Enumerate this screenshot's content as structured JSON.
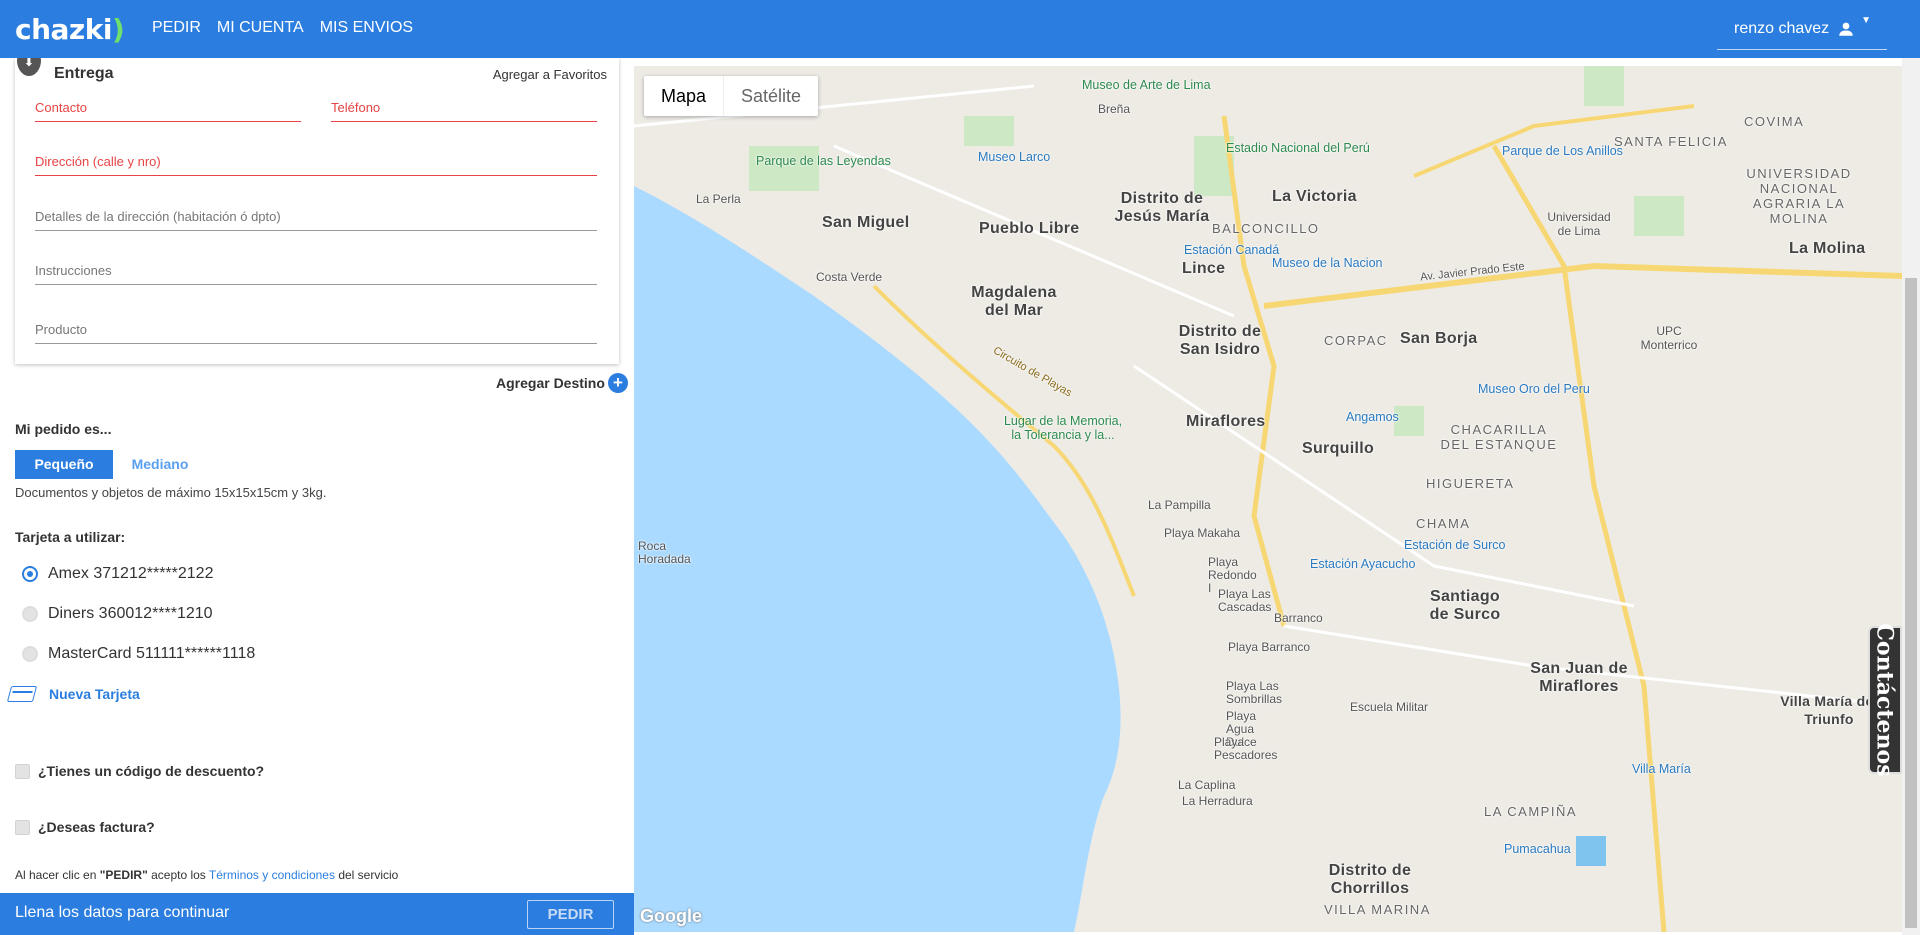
{
  "header": {
    "logo": "chazki",
    "nav": [
      "PEDIR",
      "MI CUENTA",
      "MIS ENVIOS"
    ],
    "user_name": "renzo chavez"
  },
  "delivery_card": {
    "title": "Entrega",
    "favorites_link": "Agregar a Favoritos",
    "contact_placeholder": "Contacto",
    "phone_placeholder": "Teléfono",
    "address_placeholder": "Dirección (calle y nro)",
    "details_placeholder": "Detalles de la dirección (habitación ó dpto)",
    "instructions_placeholder": "Instrucciones",
    "product_placeholder": "Producto"
  },
  "add_destination_label": "Agregar Destino",
  "order": {
    "heading": "Mi pedido es...",
    "sizes": [
      "Pequeño",
      "Mediano"
    ],
    "selected_size": "Pequeño",
    "size_description": "Documentos y objetos de máximo 15x15x15cm y 3kg."
  },
  "payment": {
    "heading": "Tarjeta a utilizar:",
    "cards": [
      {
        "label": "Amex 371212*****2122",
        "selected": true
      },
      {
        "label": "Diners 360012****1210",
        "selected": false
      },
      {
        "label": "MasterCard 511111******1118",
        "selected": false
      }
    ],
    "new_card_label": "Nueva Tarjeta"
  },
  "options": {
    "discount_label": "¿Tienes un código de descuento?",
    "invoice_label": "¿Deseas factura?"
  },
  "terms": {
    "prefix": "Al hacer clic en ",
    "action": "\"PEDIR\"",
    "middle": " acepto los ",
    "link": "Términos y condiciones",
    "suffix": " del servicio"
  },
  "footer": {
    "message": "Llena los datos para continuar",
    "button": "PEDIR"
  },
  "map": {
    "type_options": [
      "Mapa",
      "Satélite"
    ],
    "selected_type": "Mapa",
    "attribution": "Google",
    "labels": {
      "districts": [
        "San Miguel",
        "Pueblo Libre",
        "Magdalena del Mar",
        "Distrito de Jesús María",
        "Lince",
        "La Victoria",
        "Distrito de San Isidro",
        "San Borja",
        "Miraflores",
        "Surquillo",
        "Santiago de Surco",
        "San Juan de Miraflores",
        "Distrito de Chorrillos",
        "La Molina",
        "Villa María del Triunfo"
      ],
      "areas": [
        "BALCONCILLO",
        "CORPAC",
        "CHACARILLA DEL ESTANQUE",
        "HIGUERETA",
        "CHAMA",
        "LA CAMPIÑA",
        "VILLA MARINA",
        "COVIMA",
        "SANTA FELICIA",
        "UNIVERSIDAD NACIONAL AGRARIA LA MOLINA"
      ],
      "places": [
        "Museo de Arte de Lima",
        "Estadio Nacional del Perú",
        "Parque de Los Anillos",
        "Parque de las Leyendas",
        "Museo Larco",
        "Estación Canadá",
        "Museo de la Nacion",
        "Museo Oro del Peru",
        "Angamos",
        "Estación de Surco",
        "Estación Ayacucho",
        "Lugar de la Memoria, la Tolerancia y la...",
        "Escuela Militar",
        "Villa María",
        "Pumacahua",
        "Universidad de Lima",
        "UPC Monterrico"
      ],
      "coast": [
        "La Perla",
        "Costa Verde",
        "La Pampilla",
        "Playa Makaha",
        "Playa Redondo I",
        "Playa Las Cascadas",
        "Barranco",
        "Playa Barranco",
        "Playa Las Sombrillas",
        "Playa Agua Dulce",
        "Playa Pescadores",
        "La Caplina",
        "La Herradura",
        "Roca Horadada",
        "Breña"
      ],
      "roads": [
        "Av. Javier Prado Este",
        "Circuito de Playas"
      ]
    }
  },
  "contact_tab": "Contáctenos"
}
